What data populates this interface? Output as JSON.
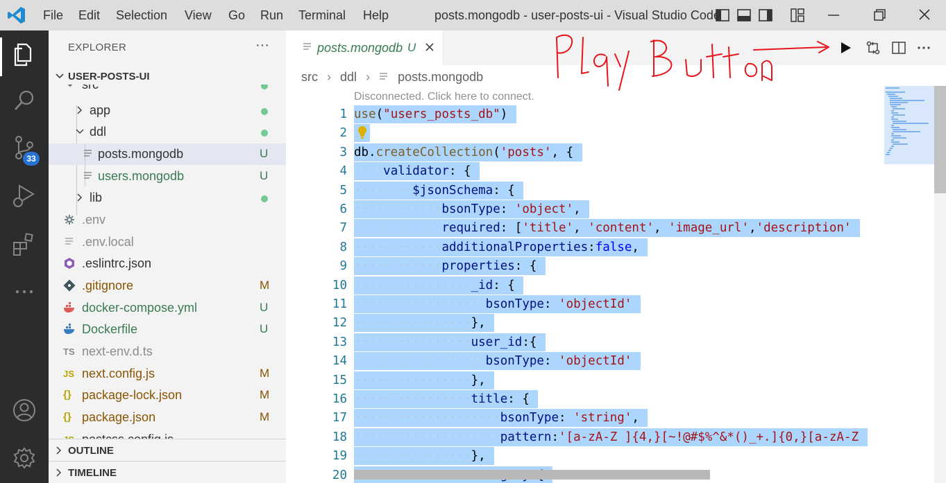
{
  "titlebar": {
    "menu": [
      "File",
      "Edit",
      "Selection",
      "View",
      "Go",
      "Run",
      "Terminal",
      "Help"
    ],
    "window_title": "posts.mongodb - user-posts-ui - Visual Studio Code"
  },
  "activitybar": {
    "scm_badge": "33"
  },
  "sidebar": {
    "title": "EXPLORER",
    "root": "USER-POSTS-UI",
    "items": [
      {
        "label": "src",
        "status": ""
      },
      {
        "label": "app",
        "status": ""
      },
      {
        "label": "ddl",
        "status": ""
      },
      {
        "label": "posts.mongodb",
        "status": "U"
      },
      {
        "label": "users.mongodb",
        "status": "U"
      },
      {
        "label": "lib",
        "status": ""
      },
      {
        "label": ".env",
        "status": ""
      },
      {
        "label": ".env.local",
        "status": ""
      },
      {
        "label": ".eslintrc.json",
        "status": ""
      },
      {
        "label": ".gitignore",
        "status": "M"
      },
      {
        "label": "docker-compose.yml",
        "status": "U"
      },
      {
        "label": "Dockerfile",
        "status": "U"
      },
      {
        "label": "next-env.d.ts",
        "status": ""
      },
      {
        "label": "next.config.js",
        "status": "M"
      },
      {
        "label": "package-lock.json",
        "status": "M"
      },
      {
        "label": "package.json",
        "status": "M"
      },
      {
        "label": "postcss.config.js",
        "status": ""
      }
    ],
    "sections": [
      "OUTLINE",
      "TIMELINE"
    ]
  },
  "editor": {
    "tab": {
      "label": "posts.mongodb",
      "status": "U"
    },
    "breadcrumb": [
      "src",
      "ddl",
      "posts.mongodb"
    ],
    "codelens": "Disconnected. Click here to connect.",
    "lines": [
      {
        "no": "1",
        "text": "use(\"users_posts_db\")"
      },
      {
        "no": "2",
        "text": ""
      },
      {
        "no": "3",
        "text": "db.createCollection('posts', {"
      },
      {
        "no": "4",
        "text": "    validator: {"
      },
      {
        "no": "5",
        "text": "        $jsonSchema: {"
      },
      {
        "no": "6",
        "text": "            bsonType: 'object',"
      },
      {
        "no": "7",
        "text": "            required: ['title', 'content', 'image_url','description'"
      },
      {
        "no": "8",
        "text": "            additionalProperties:false,"
      },
      {
        "no": "9",
        "text": "            properties: {"
      },
      {
        "no": "10",
        "text": "                _id: {"
      },
      {
        "no": "11",
        "text": "                  bsonType: 'objectId'"
      },
      {
        "no": "12",
        "text": "                },"
      },
      {
        "no": "13",
        "text": "                user_id:{"
      },
      {
        "no": "14",
        "text": "                  bsonType: 'objectId'"
      },
      {
        "no": "15",
        "text": "                },"
      },
      {
        "no": "16",
        "text": "                title: {"
      },
      {
        "no": "17",
        "text": "                    bsonType: 'string',"
      },
      {
        "no": "18",
        "text": "                    pattern:'[a-zA-Z ]{4,}[~!@#$%^&*()_+.]{0,}[a-zA-Z"
      },
      {
        "no": "19",
        "text": "                },"
      },
      {
        "no": "20",
        "text": "                category:{"
      }
    ]
  },
  "annotation": {
    "text": "Play Button",
    "color": "#e8141b"
  }
}
